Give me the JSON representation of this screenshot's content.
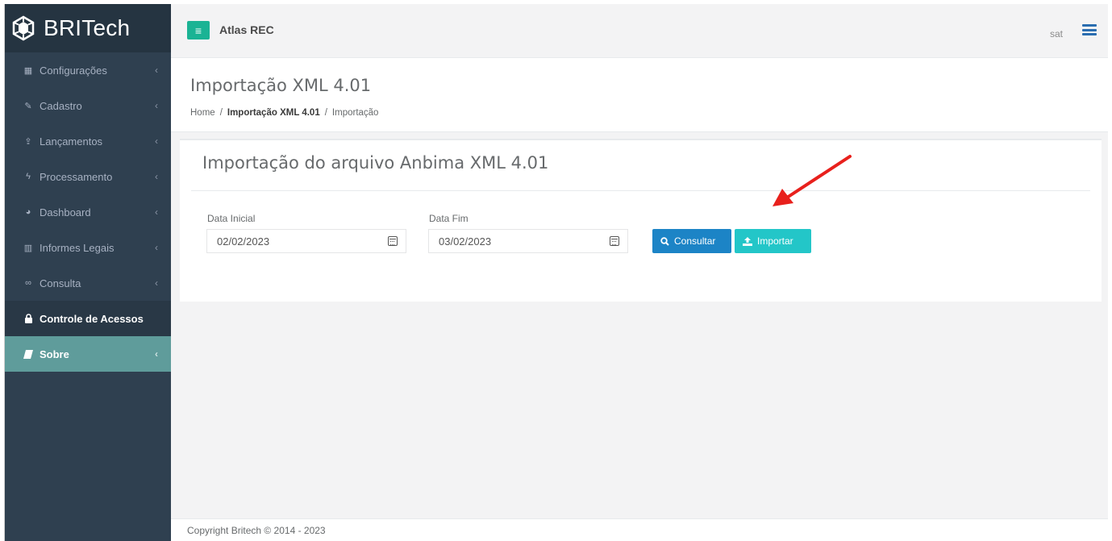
{
  "brand": {
    "name": "BRITech"
  },
  "sidebar": {
    "items": [
      {
        "label": "Configurações",
        "icon": "grid-icon",
        "glyph": "▦",
        "chevron": "‹"
      },
      {
        "label": "Cadastro",
        "icon": "edit-icon",
        "glyph": "✎",
        "chevron": "‹"
      },
      {
        "label": "Lançamentos",
        "icon": "upload-icon",
        "glyph": "⇪",
        "chevron": "‹"
      },
      {
        "label": "Processamento",
        "icon": "bolt-icon",
        "glyph": "ϟ",
        "chevron": "‹"
      },
      {
        "label": "Dashboard",
        "icon": "pie-chart-icon",
        "glyph": "◕",
        "chevron": "‹"
      },
      {
        "label": "Informes Legais",
        "icon": "building-icon",
        "glyph": "▥",
        "chevron": "‹"
      },
      {
        "label": "Consulta",
        "icon": "binoculars-icon",
        "glyph": "∞",
        "chevron": "‹"
      },
      {
        "label": "Controle de Acessos",
        "icon": "lock-icon",
        "glyph": "🔒"
      },
      {
        "label": "Sobre",
        "icon": "book-icon",
        "glyph": "▰",
        "chevron": "‹"
      }
    ]
  },
  "topbar": {
    "menu_glyph": "≡",
    "app_title": "Atlas REC",
    "user": "sat"
  },
  "heading": {
    "title": "Importação XML 4.01",
    "breadcrumb": [
      "Home",
      "Importação XML 4.01",
      "Importação"
    ],
    "separator": "/"
  },
  "panel": {
    "title": "Importação do arquivo Anbima XML 4.01",
    "start_date_label": "Data Inicial",
    "start_date_value": "02/02/2023",
    "end_date_label": "Data Fim",
    "end_date_value": "03/02/2023",
    "consultar_label": "Consultar",
    "importar_label": "Importar"
  },
  "footer": {
    "text": "Copyright Britech © 2014 - 2023"
  },
  "colors": {
    "sidebar": "#2f4050",
    "active_item": "#5f9c9b",
    "primary_button": "#1c84c6",
    "info_button": "#23c6c8",
    "menu_button": "#1ab394",
    "annotation_arrow": "#e8201c"
  }
}
